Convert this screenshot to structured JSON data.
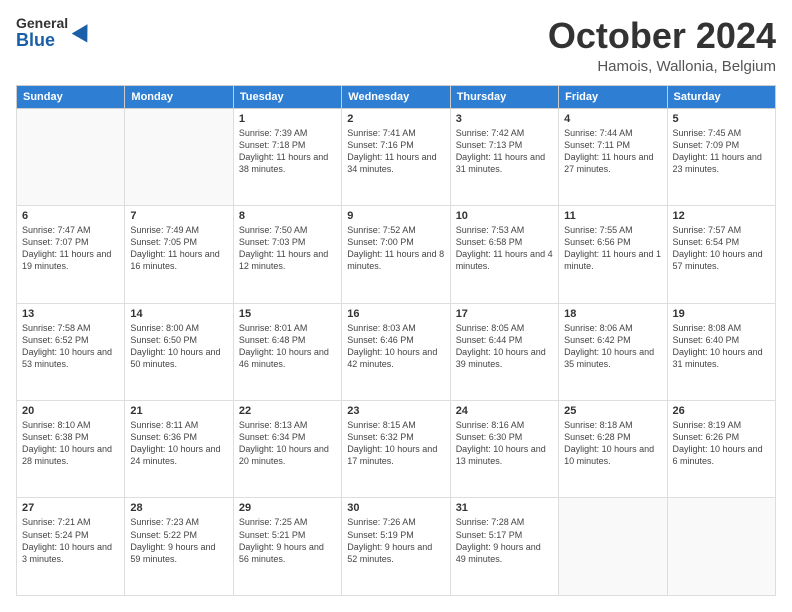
{
  "header": {
    "logo_general": "General",
    "logo_blue": "Blue",
    "month_title": "October 2024",
    "location": "Hamois, Wallonia, Belgium"
  },
  "days_of_week": [
    "Sunday",
    "Monday",
    "Tuesday",
    "Wednesday",
    "Thursday",
    "Friday",
    "Saturday"
  ],
  "weeks": [
    [
      {
        "day": "",
        "content": ""
      },
      {
        "day": "",
        "content": ""
      },
      {
        "day": "1",
        "content": "Sunrise: 7:39 AM\nSunset: 7:18 PM\nDaylight: 11 hours and 38 minutes."
      },
      {
        "day": "2",
        "content": "Sunrise: 7:41 AM\nSunset: 7:16 PM\nDaylight: 11 hours and 34 minutes."
      },
      {
        "day": "3",
        "content": "Sunrise: 7:42 AM\nSunset: 7:13 PM\nDaylight: 11 hours and 31 minutes."
      },
      {
        "day": "4",
        "content": "Sunrise: 7:44 AM\nSunset: 7:11 PM\nDaylight: 11 hours and 27 minutes."
      },
      {
        "day": "5",
        "content": "Sunrise: 7:45 AM\nSunset: 7:09 PM\nDaylight: 11 hours and 23 minutes."
      }
    ],
    [
      {
        "day": "6",
        "content": "Sunrise: 7:47 AM\nSunset: 7:07 PM\nDaylight: 11 hours and 19 minutes."
      },
      {
        "day": "7",
        "content": "Sunrise: 7:49 AM\nSunset: 7:05 PM\nDaylight: 11 hours and 16 minutes."
      },
      {
        "day": "8",
        "content": "Sunrise: 7:50 AM\nSunset: 7:03 PM\nDaylight: 11 hours and 12 minutes."
      },
      {
        "day": "9",
        "content": "Sunrise: 7:52 AM\nSunset: 7:00 PM\nDaylight: 11 hours and 8 minutes."
      },
      {
        "day": "10",
        "content": "Sunrise: 7:53 AM\nSunset: 6:58 PM\nDaylight: 11 hours and 4 minutes."
      },
      {
        "day": "11",
        "content": "Sunrise: 7:55 AM\nSunset: 6:56 PM\nDaylight: 11 hours and 1 minute."
      },
      {
        "day": "12",
        "content": "Sunrise: 7:57 AM\nSunset: 6:54 PM\nDaylight: 10 hours and 57 minutes."
      }
    ],
    [
      {
        "day": "13",
        "content": "Sunrise: 7:58 AM\nSunset: 6:52 PM\nDaylight: 10 hours and 53 minutes."
      },
      {
        "day": "14",
        "content": "Sunrise: 8:00 AM\nSunset: 6:50 PM\nDaylight: 10 hours and 50 minutes."
      },
      {
        "day": "15",
        "content": "Sunrise: 8:01 AM\nSunset: 6:48 PM\nDaylight: 10 hours and 46 minutes."
      },
      {
        "day": "16",
        "content": "Sunrise: 8:03 AM\nSunset: 6:46 PM\nDaylight: 10 hours and 42 minutes."
      },
      {
        "day": "17",
        "content": "Sunrise: 8:05 AM\nSunset: 6:44 PM\nDaylight: 10 hours and 39 minutes."
      },
      {
        "day": "18",
        "content": "Sunrise: 8:06 AM\nSunset: 6:42 PM\nDaylight: 10 hours and 35 minutes."
      },
      {
        "day": "19",
        "content": "Sunrise: 8:08 AM\nSunset: 6:40 PM\nDaylight: 10 hours and 31 minutes."
      }
    ],
    [
      {
        "day": "20",
        "content": "Sunrise: 8:10 AM\nSunset: 6:38 PM\nDaylight: 10 hours and 28 minutes."
      },
      {
        "day": "21",
        "content": "Sunrise: 8:11 AM\nSunset: 6:36 PM\nDaylight: 10 hours and 24 minutes."
      },
      {
        "day": "22",
        "content": "Sunrise: 8:13 AM\nSunset: 6:34 PM\nDaylight: 10 hours and 20 minutes."
      },
      {
        "day": "23",
        "content": "Sunrise: 8:15 AM\nSunset: 6:32 PM\nDaylight: 10 hours and 17 minutes."
      },
      {
        "day": "24",
        "content": "Sunrise: 8:16 AM\nSunset: 6:30 PM\nDaylight: 10 hours and 13 minutes."
      },
      {
        "day": "25",
        "content": "Sunrise: 8:18 AM\nSunset: 6:28 PM\nDaylight: 10 hours and 10 minutes."
      },
      {
        "day": "26",
        "content": "Sunrise: 8:19 AM\nSunset: 6:26 PM\nDaylight: 10 hours and 6 minutes."
      }
    ],
    [
      {
        "day": "27",
        "content": "Sunrise: 7:21 AM\nSunset: 5:24 PM\nDaylight: 10 hours and 3 minutes."
      },
      {
        "day": "28",
        "content": "Sunrise: 7:23 AM\nSunset: 5:22 PM\nDaylight: 9 hours and 59 minutes."
      },
      {
        "day": "29",
        "content": "Sunrise: 7:25 AM\nSunset: 5:21 PM\nDaylight: 9 hours and 56 minutes."
      },
      {
        "day": "30",
        "content": "Sunrise: 7:26 AM\nSunset: 5:19 PM\nDaylight: 9 hours and 52 minutes."
      },
      {
        "day": "31",
        "content": "Sunrise: 7:28 AM\nSunset: 5:17 PM\nDaylight: 9 hours and 49 minutes."
      },
      {
        "day": "",
        "content": ""
      },
      {
        "day": "",
        "content": ""
      }
    ]
  ]
}
